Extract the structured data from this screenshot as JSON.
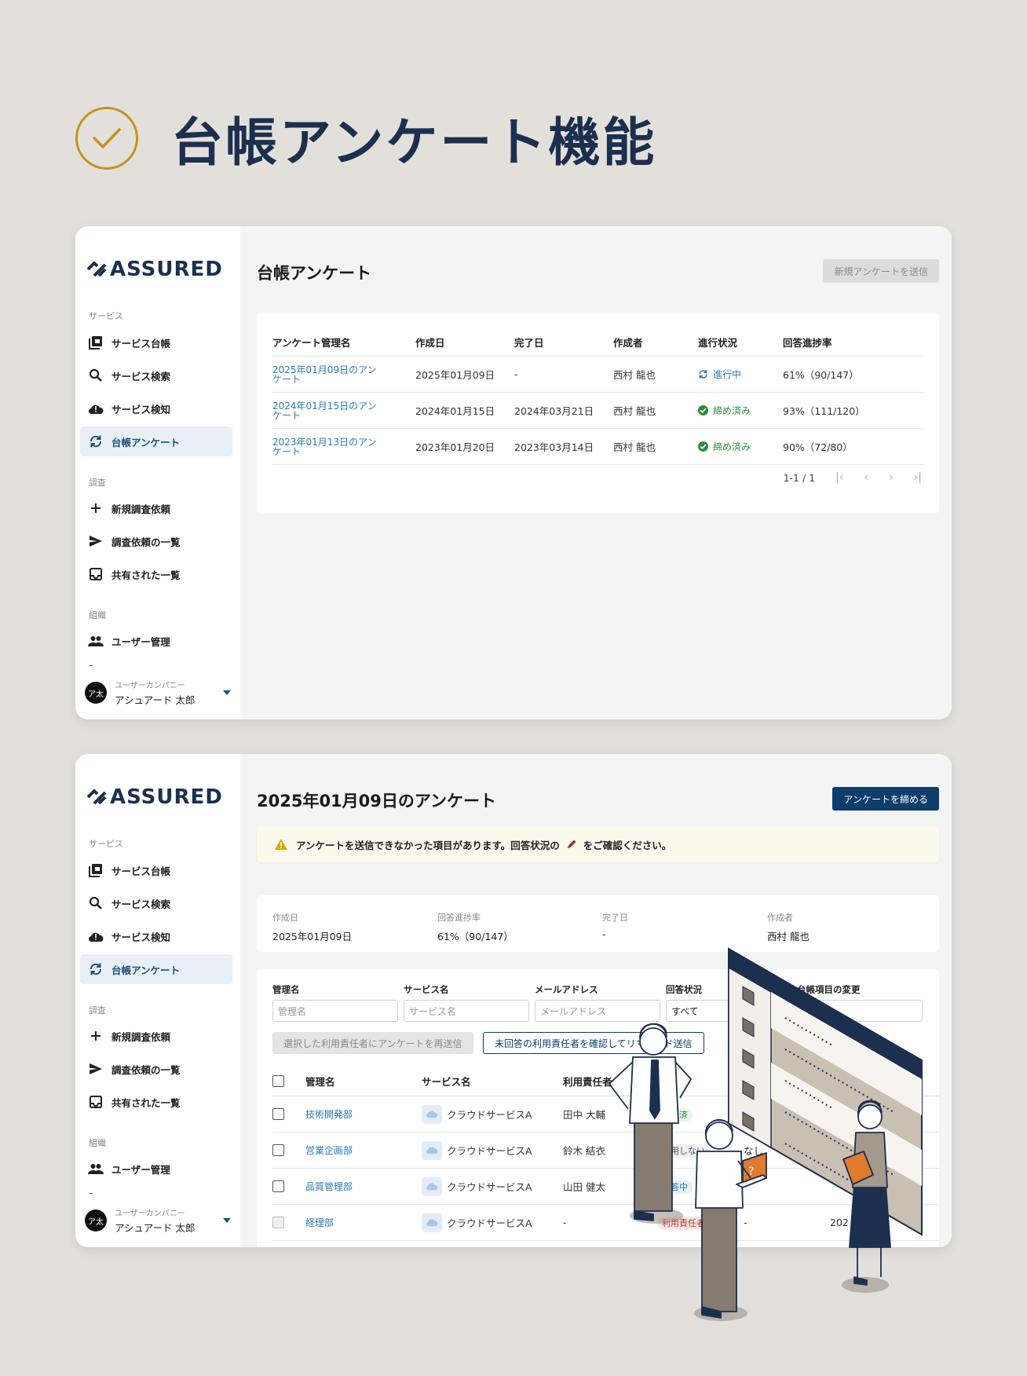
{
  "hero": {
    "title": "台帳アンケート機能"
  },
  "brand": {
    "name": "ASSURED",
    "navy": "#1d2f4e",
    "gold": "#c4921e",
    "primary": "#0d3d6b"
  },
  "sidebar": {
    "section_service": "サービス",
    "items_service": [
      "サービス台帳",
      "サービス検索",
      "サービス検知",
      "台帳アンケート"
    ],
    "section_survey": "調査",
    "items_survey": [
      "新規調査依頼",
      "調査依頼の一覧",
      "共有された一覧"
    ],
    "section_org": "組織",
    "items_org": [
      "ユーザー管理"
    ],
    "sep": "–",
    "user": {
      "avatar": "ア太",
      "company": "ユーザーカンパニー",
      "name": "アシュアード 太郎"
    }
  },
  "screen1": {
    "title": "台帳アンケート",
    "new_button": "新規アンケートを送信",
    "columns": [
      "アンケート管理名",
      "作成日",
      "完了日",
      "作成者",
      "進行状況",
      "回答進捗率"
    ],
    "rows": [
      {
        "name": "2025年01月09日のアンケート",
        "created": "2025年01月09日",
        "completed": "-",
        "author": "西村 龍也",
        "status": "進行中",
        "progress": "61%（90/147）"
      },
      {
        "name": "2024年01月15日のアンケート",
        "created": "2024年01月15日",
        "completed": "2024年03月21日",
        "author": "西村 龍也",
        "status": "締め済み",
        "progress": "93%（111/120）"
      },
      {
        "name": "2023年01月13日のアンケート",
        "created": "2023年01月20日",
        "completed": "2023年03月14日",
        "author": "西村 龍也",
        "status": "締め済み",
        "progress": "90%（72/80）"
      }
    ],
    "pager": "1-1 / 1"
  },
  "screen2": {
    "title": "2025年01月09日のアンケート",
    "close_button": "アンケートを締める",
    "alert_pre": "アンケートを送信できなかった項目があります。回答状況の",
    "alert_post": "をご確認ください。",
    "info": [
      {
        "label": "作成日",
        "value": "2025年01月09日"
      },
      {
        "label": "回答進捗率",
        "value": "61%（90/147）"
      },
      {
        "label": "完了日",
        "value": "-"
      },
      {
        "label": "作成者",
        "value": "西村 龍也"
      }
    ],
    "filters": [
      {
        "label": "管理名",
        "placeholder": "管理名"
      },
      {
        "label": "サービス名",
        "placeholder": "サービス名"
      },
      {
        "label": "メールアドレス",
        "placeholder": "メールアドレス"
      },
      {
        "label": "回答状況",
        "value": "すべて"
      },
      {
        "label": "台帳項目の変更"
      }
    ],
    "resend_button": "選択した利用責任者にアンケートを再送信",
    "remind_button": "未回答の利用責任者を確認してリマインド送信",
    "columns": [
      "管理名",
      "サービス名",
      "利用責任者",
      "回"
    ],
    "rows": [
      {
        "dept": "技術開発部",
        "service": "クラウドサービスA",
        "owner": "田中 大輔",
        "status": "回答済"
      },
      {
        "dept": "営業企画部",
        "service": "クラウドサービスA",
        "owner": "鈴木 結衣",
        "status": "利用しない",
        "extra": "なし"
      },
      {
        "dept": "品質管理部",
        "service": "クラウドサービスA",
        "owner": "山田 健太",
        "status": "回答中"
      },
      {
        "dept": "経理部",
        "service": "クラウドサービスA",
        "owner": "-",
        "status": "利用責任者",
        "extra": "-",
        "date": "202"
      }
    ]
  }
}
